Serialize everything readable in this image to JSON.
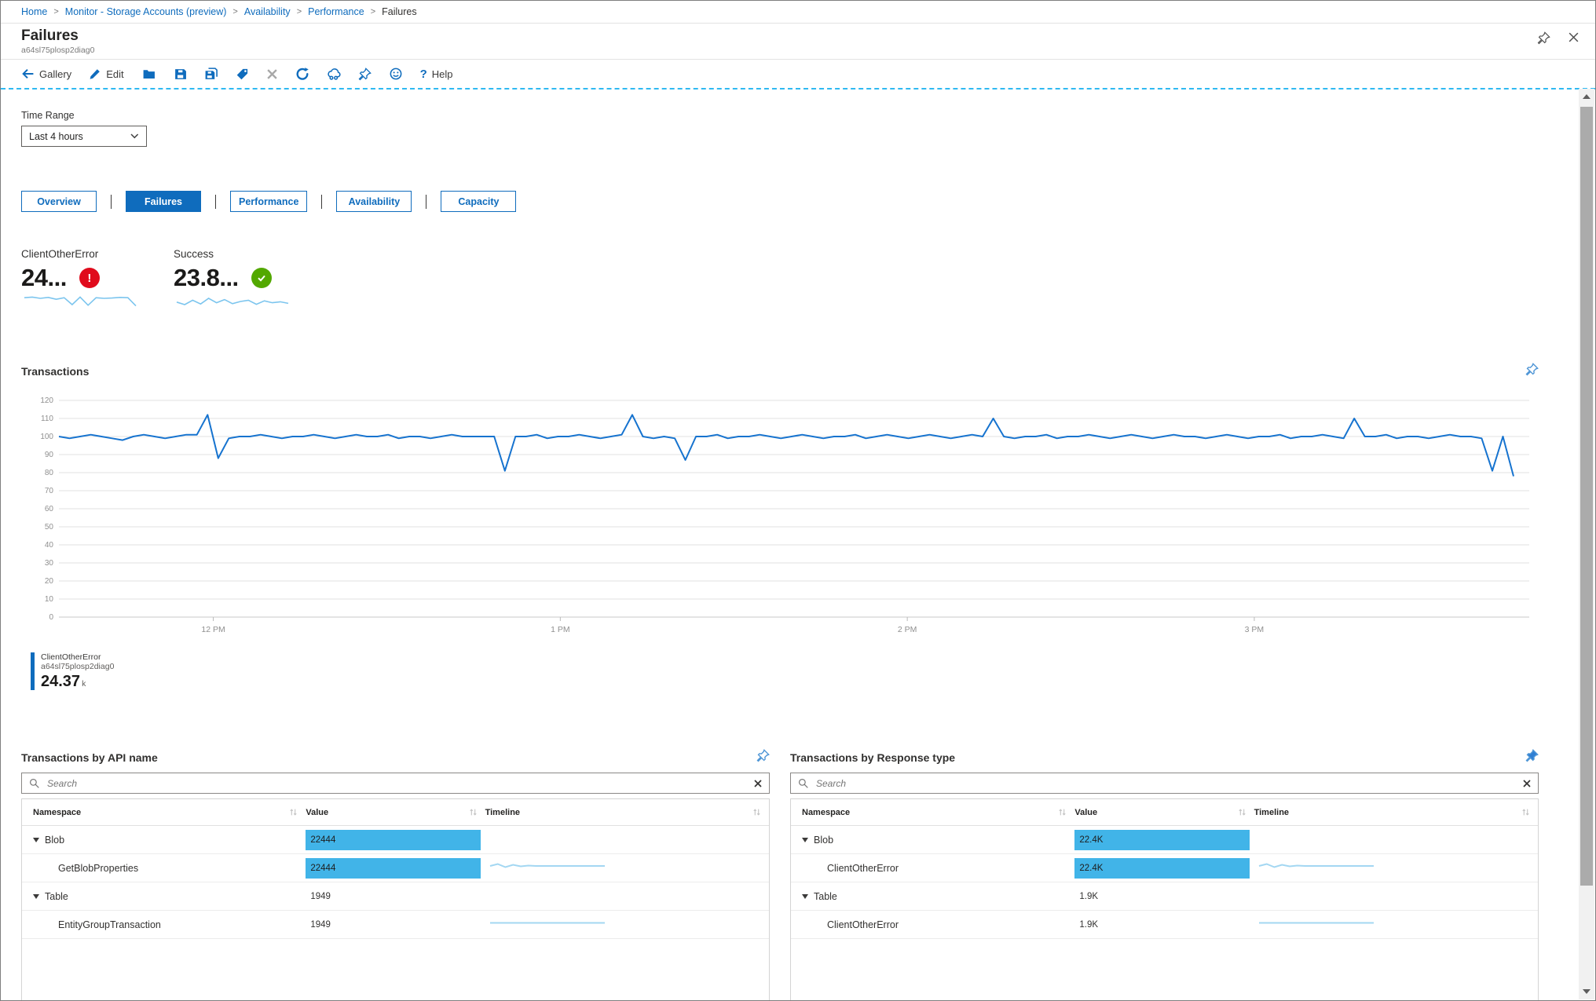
{
  "breadcrumb": [
    "Home",
    "Monitor - Storage Accounts (preview)",
    "Availability",
    "Performance",
    "Failures"
  ],
  "header": {
    "title": "Failures",
    "subtitle": "a64sl75plosp2diag0"
  },
  "toolbar": {
    "gallery_label": "Gallery",
    "edit_label": "Edit",
    "help_label": "Help",
    "icon_buttons": [
      "folder-icon",
      "save-icon",
      "save-as-icon",
      "tag-icon",
      "x-icon",
      "refresh-icon",
      "share-icon",
      "pin-icon",
      "smiley-icon"
    ]
  },
  "filters": {
    "time_range_label": "Time Range",
    "time_range_value": "Last 4 hours"
  },
  "tabs": [
    {
      "label": "Overview",
      "active": false
    },
    {
      "label": "Failures",
      "active": true
    },
    {
      "label": "Performance",
      "active": false
    },
    {
      "label": "Availability",
      "active": false
    },
    {
      "label": "Capacity",
      "active": false
    }
  ],
  "metrics": [
    {
      "label": "ClientOtherError",
      "value_display": "24...",
      "status": "error",
      "spark_values": [
        52,
        54,
        50,
        53,
        47,
        52,
        30,
        54,
        28,
        52,
        50,
        51,
        53,
        52,
        26
      ]
    },
    {
      "label": "Success",
      "value_display": "23.8...",
      "status": "success",
      "spark_values": [
        38,
        30,
        44,
        32,
        50,
        36,
        46,
        33,
        40,
        44,
        31,
        42,
        36,
        39,
        34
      ]
    }
  ],
  "chart_section": {
    "title": "Transactions"
  },
  "chart_data": {
    "type": "line",
    "title": "Transactions",
    "x_axis": {
      "ticks": [
        "12 PM",
        "1 PM",
        "2 PM",
        "3 PM"
      ],
      "tick_fractions": [
        0.105,
        0.341,
        0.577,
        0.813
      ]
    },
    "y_axis": {
      "min": 0,
      "max": 120,
      "step": 10
    },
    "grid": true,
    "legend_position": "bottom-left",
    "series": [
      {
        "name": "ClientOtherError",
        "resource": "a64sl75plosp2diag0",
        "total_display": "24.37k",
        "color": "#1673cf",
        "values": [
          100,
          99,
          100,
          101,
          100,
          99,
          98,
          100,
          101,
          100,
          99,
          100,
          101,
          101,
          112,
          88,
          99,
          100,
          100,
          101,
          100,
          99,
          100,
          100,
          101,
          100,
          99,
          100,
          101,
          100,
          100,
          101,
          99,
          100,
          100,
          99,
          100,
          101,
          100,
          100,
          100,
          100,
          81,
          100,
          100,
          101,
          99,
          100,
          100,
          101,
          100,
          99,
          100,
          101,
          112,
          100,
          99,
          100,
          99,
          87,
          100,
          100,
          101,
          99,
          100,
          100,
          101,
          100,
          99,
          100,
          101,
          100,
          99,
          100,
          100,
          101,
          99,
          100,
          101,
          100,
          99,
          100,
          101,
          100,
          99,
          100,
          101,
          100,
          110,
          100,
          99,
          100,
          100,
          101,
          99,
          100,
          100,
          101,
          100,
          99,
          100,
          101,
          100,
          99,
          100,
          101,
          100,
          100,
          99,
          100,
          101,
          100,
          99,
          100,
          100,
          101,
          99,
          100,
          100,
          101,
          100,
          99,
          110,
          100,
          100,
          101,
          99,
          100,
          100,
          99,
          100,
          101,
          100,
          100,
          99,
          81,
          100,
          78
        ]
      }
    ]
  },
  "legend": {
    "name": "ClientOtherError",
    "resource": "a64sl75plosp2diag0",
    "value": "24.37",
    "unit": "k"
  },
  "tables": [
    {
      "title": "Transactions by API name",
      "search_placeholder": "Search",
      "columns": [
        "Namespace",
        "Value",
        "Timeline"
      ],
      "rows": [
        {
          "name": "Blob",
          "value": "22444",
          "bar": true,
          "child": false,
          "spark": null
        },
        {
          "name": "GetBlobProperties",
          "value": "22444",
          "bar": true,
          "child": true,
          "spark": "wiggle"
        },
        {
          "name": "Table",
          "value": "1949",
          "bar": false,
          "child": false,
          "spark": null
        },
        {
          "name": "EntityGroupTransaction",
          "value": "1949",
          "bar": false,
          "child": true,
          "spark": "flat"
        }
      ]
    },
    {
      "title": "Transactions by Response type",
      "search_placeholder": "Search",
      "columns": [
        "Namespace",
        "Value",
        "Timeline"
      ],
      "rows": [
        {
          "name": "Blob",
          "value": "22.4K",
          "bar": true,
          "child": false,
          "spark": null
        },
        {
          "name": "ClientOtherError",
          "value": "22.4K",
          "bar": true,
          "child": true,
          "spark": "wiggle"
        },
        {
          "name": "Table",
          "value": "1.9K",
          "bar": false,
          "child": false,
          "spark": null
        },
        {
          "name": "ClientOtherError",
          "value": "1.9K",
          "bar": false,
          "child": true,
          "spark": "flat"
        }
      ]
    }
  ],
  "colors": {
    "accent": "#0f6cbd",
    "chart_line": "#1673cf",
    "bar_fill": "#41b4e8",
    "tile_sparkline": "#7cc5ee",
    "table_sparkline": "#a3d7f2",
    "error": "#e00b1c",
    "success": "#52a800",
    "selection_dash": "#2fb9f2"
  }
}
